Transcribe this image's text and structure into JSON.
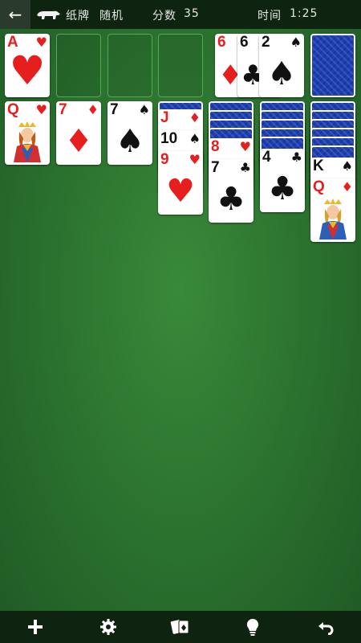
{
  "header": {
    "title": "纸牌",
    "mode": "随机",
    "score_label": "分数",
    "score": "35",
    "time_label": "时间",
    "time": "1:25"
  },
  "foundations": [
    {
      "rank": "A",
      "suit": "♥",
      "color": "red"
    }
  ],
  "waste": [
    {
      "rank": "6",
      "suit": "♦",
      "color": "red"
    },
    {
      "rank": "6",
      "suit": "♣",
      "color": "black"
    },
    {
      "rank": "2",
      "suit": "♠",
      "color": "black"
    }
  ],
  "tableau": [
    {
      "face_down": 0,
      "cards": [
        {
          "rank": "Q",
          "suit": "♥",
          "color": "red",
          "face": "queen"
        }
      ]
    },
    {
      "face_down": 0,
      "cards": [
        {
          "rank": "7",
          "suit": "♦",
          "color": "red"
        }
      ]
    },
    {
      "face_down": 0,
      "cards": [
        {
          "rank": "7",
          "suit": "♠",
          "color": "black"
        }
      ]
    },
    {
      "face_down": 1,
      "cards": [
        {
          "rank": "J",
          "suit": "♦",
          "color": "red"
        },
        {
          "rank": "10",
          "suit": "♠",
          "color": "black"
        },
        {
          "rank": "9",
          "suit": "♥",
          "color": "red"
        }
      ]
    },
    {
      "face_down": 4,
      "cards": [
        {
          "rank": "8",
          "suit": "♥",
          "color": "red"
        },
        {
          "rank": "7",
          "suit": "♣",
          "color": "black"
        }
      ]
    },
    {
      "face_down": 5,
      "cards": [
        {
          "rank": "4",
          "suit": "♣",
          "color": "black"
        }
      ]
    },
    {
      "face_down": 6,
      "cards": [
        {
          "rank": "K",
          "suit": "♠",
          "color": "black"
        },
        {
          "rank": "Q",
          "suit": "♦",
          "color": "red",
          "face": "queen"
        }
      ]
    }
  ],
  "toolbar": {
    "new_icon": "plus-icon",
    "settings_icon": "gear-icon",
    "cards_icon": "cards-icon",
    "hint_icon": "lightbulb-icon",
    "undo_icon": "undo-icon"
  },
  "colors": {
    "felt": "#2c7430",
    "bar": "#0f2410",
    "card_back": "#1d3fb5",
    "red_suit": "#e61e1e"
  }
}
